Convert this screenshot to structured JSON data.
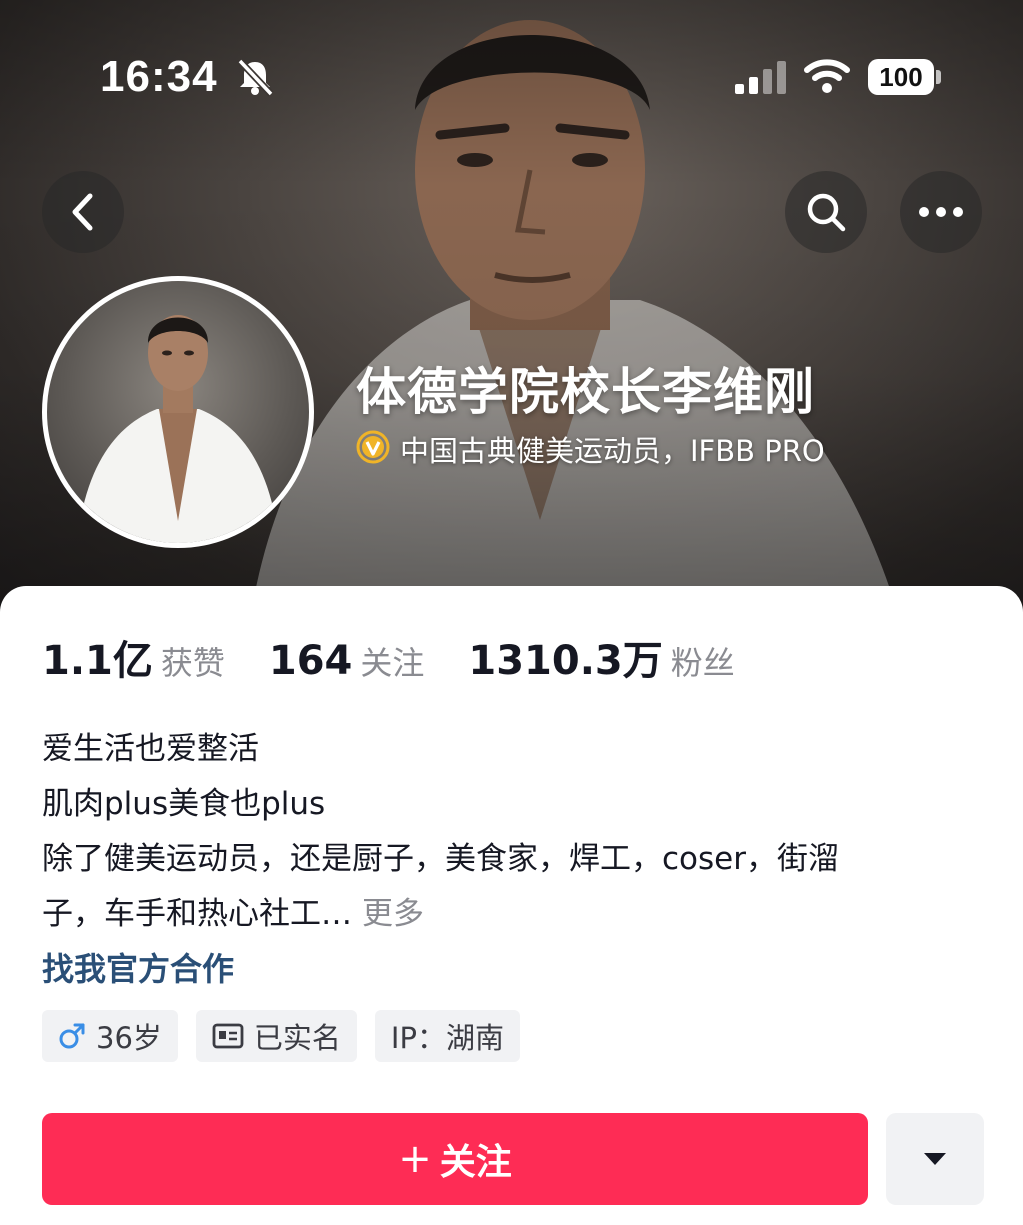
{
  "status_bar": {
    "time": "16:34",
    "battery": "100",
    "icons": [
      "bell-slash-icon",
      "signal-icon",
      "wifi-icon",
      "battery-icon"
    ]
  },
  "nav": {
    "icons": [
      "back-arrow-icon",
      "search-icon",
      "more-dots-icon"
    ]
  },
  "profile": {
    "name": "体德学院校长李维刚",
    "verified_icon": "verified-v-badge-icon",
    "verify_text": "中国古典健美运动员，IFBB PRO"
  },
  "stats": [
    {
      "value": "1.1亿",
      "label": "获赞"
    },
    {
      "value": "164",
      "label": "关注"
    },
    {
      "value": "1310.3万",
      "label": "粉丝"
    }
  ],
  "bio": {
    "lines": [
      "爱生活也爱整活",
      "肌肉plus美食也plus",
      "除了健美运动员，还是厨子，美食家，焊工，coser，街溜",
      "子，车手和热心社工…"
    ],
    "more_label": "更多"
  },
  "coop_link": "找我官方合作",
  "tags": [
    {
      "icon": "male-icon",
      "text": "36岁"
    },
    {
      "icon": "id-card-icon",
      "text": "已实名"
    },
    {
      "icon": "",
      "text": "IP：湖南"
    }
  ],
  "actions": {
    "follow_label": "关注",
    "follow_plus": "+",
    "dropdown_icon": "caret-down-icon"
  },
  "colors": {
    "accent": "#fe2c55",
    "link": "#2a4f77",
    "male_icon": "#3a8ee6",
    "verify_badge": "#f0b428"
  }
}
